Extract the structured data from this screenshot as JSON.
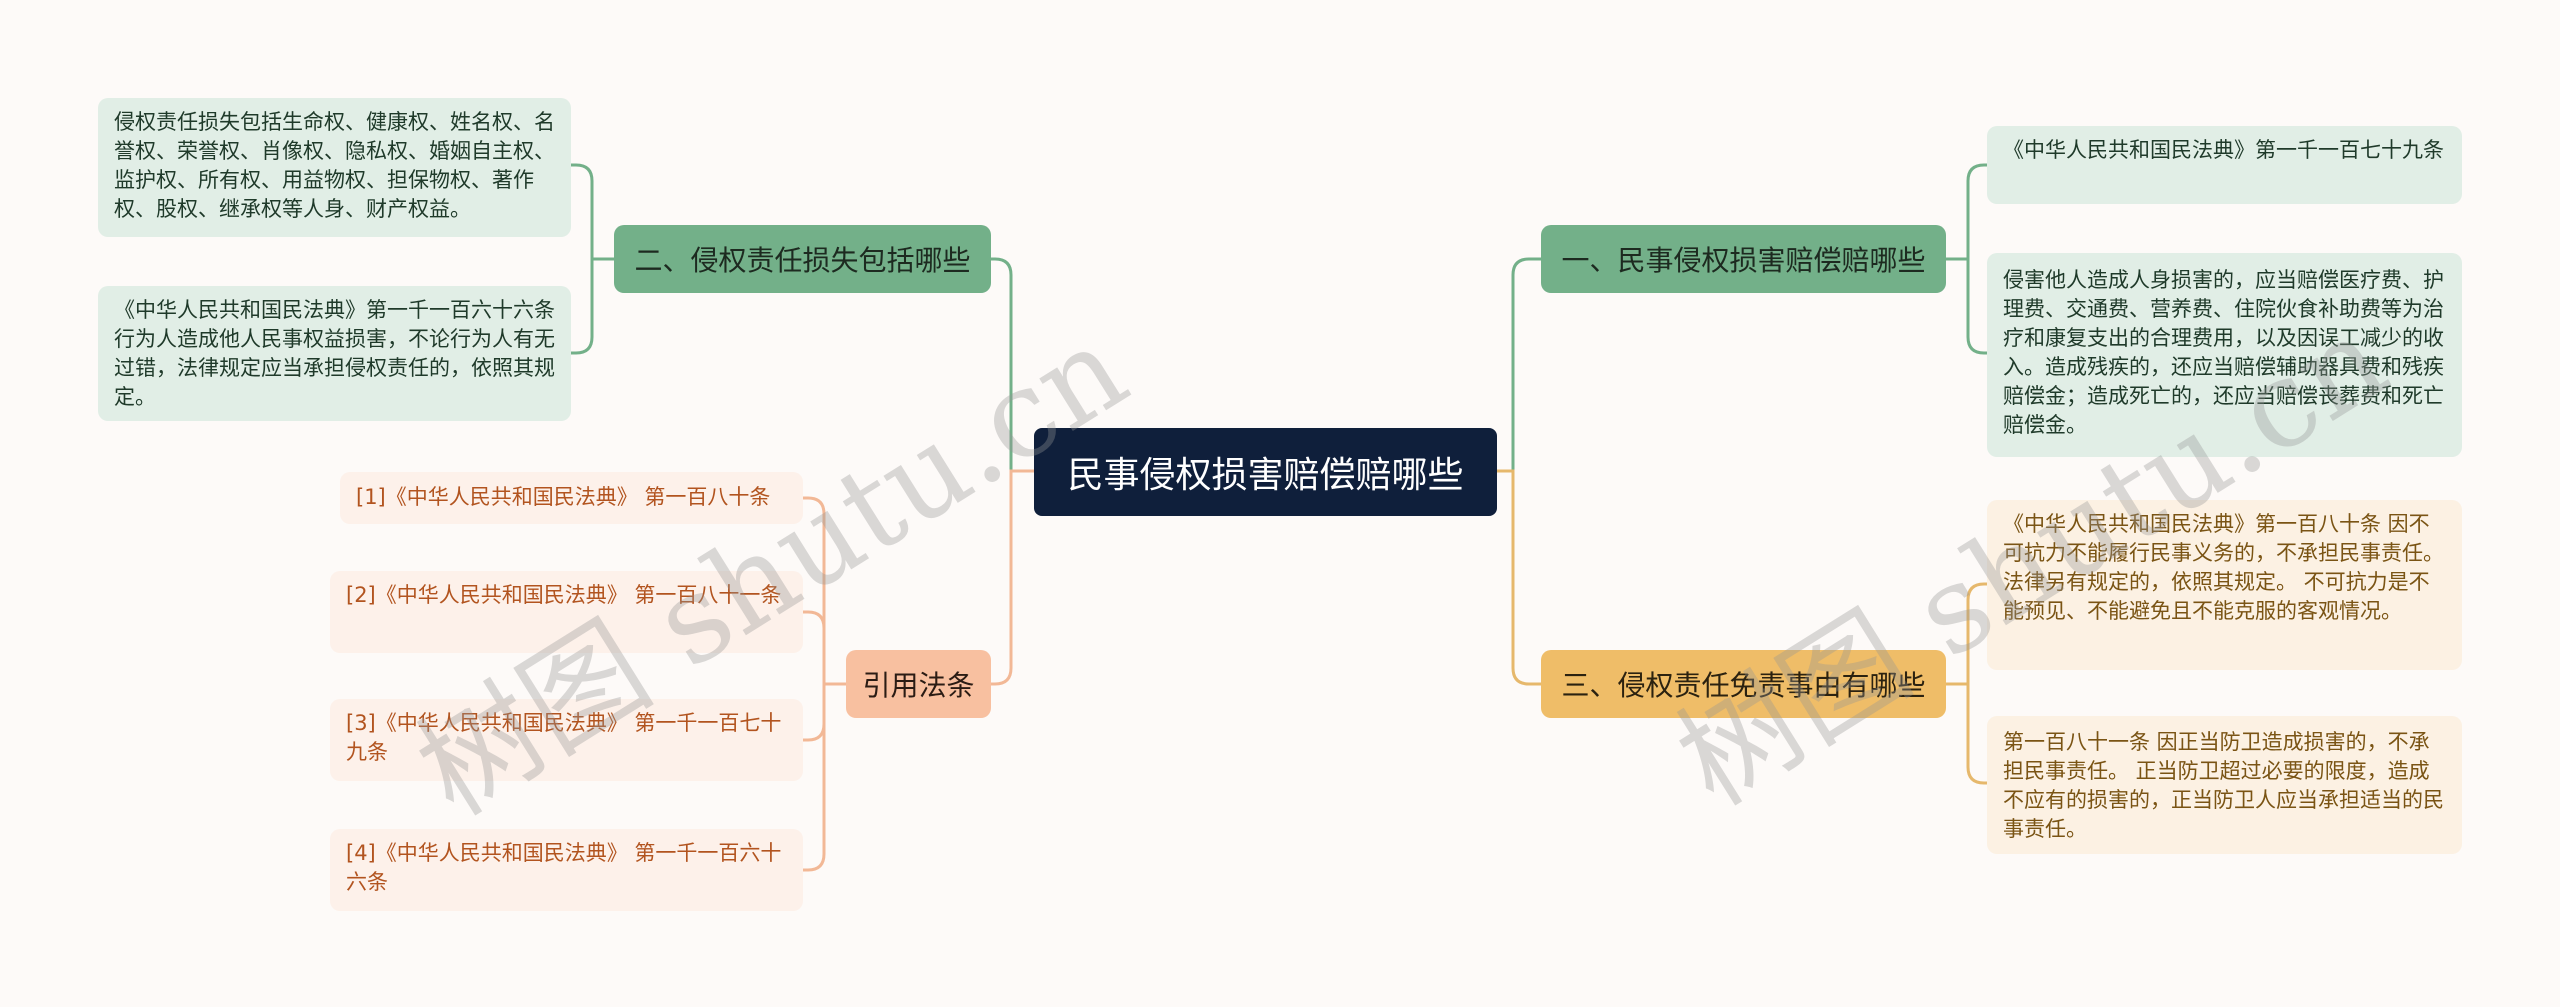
{
  "root": {
    "title": "民事侵权损害赔偿赔哪些"
  },
  "branches": {
    "one": {
      "title": "一、民事侵权损害赔偿赔哪些",
      "color": "#73b089",
      "leaves": [
        "《中华人民共和国民法典》第一千一百七十九条",
        "侵害他人造成人身损害的，应当赔偿医疗费、护理费、交通费、营养费、住院伙食补助费等为治疗和康复支出的合理费用，以及因误工减少的收入。造成残疾的，还应当赔偿辅助器具费和残疾赔偿金；造成死亡的，还应当赔偿丧葬费和死亡赔偿金。"
      ]
    },
    "two": {
      "title": "二、侵权责任损失包括哪些",
      "color": "#73b089",
      "leaves": [
        "侵权责任损失包括生命权、健康权、姓名权、名誉权、荣誉权、肖像权、隐私权、婚姻自主权、监护权、所有权、用益物权、担保物权、著作权、股权、继承权等人身、财产权益。",
        "《中华人民共和国民法典》第一千一百六十六条行为人造成他人民事权益损害，不论行为人有无过错，法律规定应当承担侵权责任的，依照其规定。"
      ]
    },
    "three": {
      "title": "三、侵权责任免责事由有哪些",
      "color": "#efbd68",
      "leaves": [
        "《中华人民共和国民法典》第一百八十条 因不可抗力不能履行民事义务的，不承担民事责任。法律另有规定的，依照其规定。 不可抗力是不能预见、不能避免且不能克服的客观情况。",
        " 第一百八十一条 因正当防卫造成损害的，不承担民事责任。 正当防卫超过必要的限度，造成不应有的损害的，正当防卫人应当承担适当的民事责任。"
      ]
    },
    "refs": {
      "title": "引用法条",
      "color": "#f8c0a0",
      "leaves": [
        "[1]《中华人民共和国民法典》 第一百八十条",
        "[2]《中华人民共和国民法典》 第一百八十一条",
        "[3]《中华人民共和国民法典》 第一千一百七十九条",
        "[4]《中华人民共和国民法典》 第一千一百六十六条"
      ]
    }
  },
  "watermarks": [
    "树图 shutu.cn",
    "树图 shutu.cn"
  ]
}
